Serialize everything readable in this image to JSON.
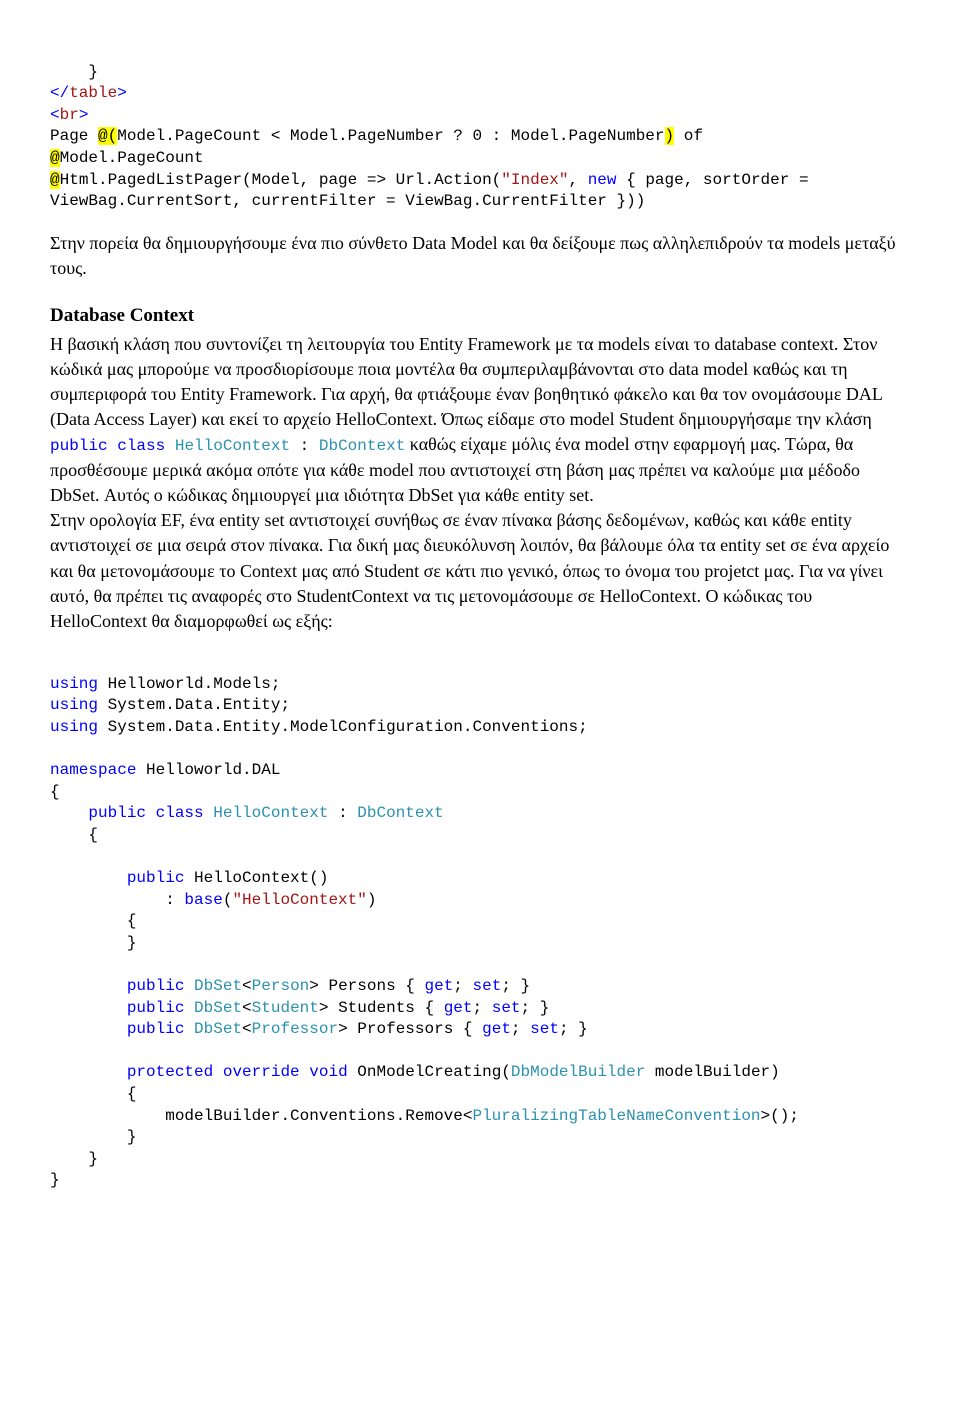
{
  "top_code": {
    "l1": "    }",
    "l2_open": "</",
    "l2_tag": "table",
    "l2_close": ">",
    "l3_open": "<",
    "l3_tag": "br",
    "l3_close": ">",
    "l4a": "Page ",
    "l4b": "@(",
    "l4c": "Model.PageCount < Model.PageNumber ? 0 : Model.PageNumber",
    "l4d": ")",
    "l4e": " of",
    "l5a": "@",
    "l5b": "Model.PageCount",
    "l6a": "@",
    "l6b": "Html.PagedListPager(Model, page => Url.Action(",
    "l6c": "\"Index\"",
    "l6d": ", ",
    "l6e": "new",
    "l6f": " { page, sortOrder =",
    "l7": "ViewBag.CurrentSort, currentFilter = ViewBag.CurrentFilter }))"
  },
  "para1": "Στην πορεία θα δημιουργήσουμε ένα πιο σύνθετο Data Model και θα δείξουμε πως αλληλεπιδρούν τα models μεταξύ τους.",
  "h1": "Database Context",
  "para2a": "Η βασική κλάση που συντονίζει τη λειτουργία του Entity Framework με τα models είναι το database context. Στον κώδικά μας μπορούμε να προσδιορίσουμε ποια μοντέλα θα συμπεριλαμβάνονται στο data model καθώς και τη συμπεριφορά του Entity Framework. Για αρχή, θα φτιάξουμε έναν βοηθητικό φάκελο και θα τον ονομάσουμε DAL (Data Access Layer) και εκεί το αρχείο HelloContext. Όπως είδαμε στο model Student δημιουργήσαμε την κλάση ",
  "inline1_kw1": "public",
  "inline1_kw2": "class",
  "inline1_cls": "HelloContext",
  "inline1_colon": " : ",
  "inline1_base": "DbContext",
  "para2b": "  καθώς είχαμε μόλις ένα model στην εφαρμογή μας. Τώρα, θα προσθέσουμε μερικά ακόμα οπότε για κάθε model που αντιστοιχεί στη βάση μας πρέπει να καλούμε μια μέδοδο DbSet.  Αυτός ο κώδικας δημιουργεί μια ιδιότητα DbSet για κάθε entity set.",
  "para3": "Στην ορολογία EF, ένα entity set αντιστοιχεί συνήθως σε έναν πίνακα βάσης δεδομένων, καθώς και κάθε entity αντιστοιχεί σε μια σειρά στον πίνακα. Για δική μας διευκόλυνση λοιπόν, θα βάλουμε όλα τα entity set σε ένα αρχείο και θα μετονομάσουμε το Context μας από Student σε κάτι πιο γενικό, όπως το όνομα του projetct μας. Για να γίνει αυτό, θα πρέπει τις αναφορές στο StudentContext να τις μετονομάσουμε σε HelloContext. Ο κώδικας του HelloContext θα διαμορφωθεί ως εξής:",
  "code2": {
    "using": "using",
    "u1b": " Helloworld.Models;",
    "u2b": " System.Data.Entity;",
    "u3b": " System.Data.Entity.ModelConfiguration.Conventions;",
    "ns": "namespace",
    "nsb": " Helloworld.DAL",
    "ob": "{",
    "ind1": "    ",
    "pub": "public",
    "cls": "class",
    "helloctx": "HelloContext",
    "colon": " : ",
    "dbctx": "DbContext",
    "ind2": "        ",
    "ind3": "            ",
    "ctor": " HelloContext()",
    "basekw": "base",
    "basestr": "\"HelloContext\"",
    "ccl": "}",
    "dbset": "DbSet",
    "person": "Person",
    "student": "Student",
    "professor": "Professor",
    "persons": "> Persons { ",
    "students": "> Students { ",
    "professors": "> Professors { ",
    "get": "get",
    "set": "set",
    "semi": "; ",
    "endprop": "; }",
    "prot": "protected",
    "ovr": "override",
    "void": "void",
    "omc": " OnModelCreating(",
    "dmbld": "DbModelBuilder",
    "mbld": " modelBuilder)",
    "rem1": "modelBuilder.Conventions.Remove<",
    "plur": "PluralizingTableNameConvention",
    "rem2": ">();",
    "lt": "<"
  }
}
